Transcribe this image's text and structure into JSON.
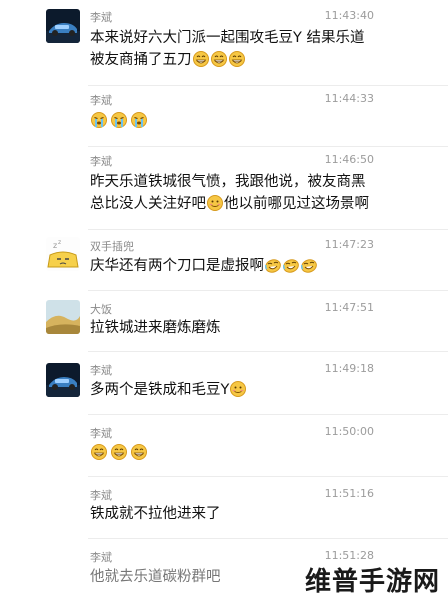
{
  "messages": [
    {
      "sender": "李斌",
      "time": "11:43:40",
      "avatar": "car-photo-avatar",
      "lines": [
        "本来说好六大门派一起围攻毛豆Y 结果乐道",
        "被友商捅了五刀"
      ]
    },
    {
      "sender": "李斌",
      "time": "11:44:33",
      "avatar": "none",
      "lines": []
    },
    {
      "sender": "李斌",
      "time": "11:46:50",
      "avatar": "none",
      "lines": [
        "昨天乐道铁城很气愤，我跟他说，被友商黑",
        "总比没人关注好吧",
        "他以前哪见过这场景啊"
      ]
    },
    {
      "sender": "双手插兜",
      "time": "11:47:23",
      "avatar": "cartoon-avatar",
      "lines": [
        "庆华还有两个刀口是虚报啊"
      ]
    },
    {
      "sender": "大饭",
      "time": "11:47:51",
      "avatar": "landscape-avatar",
      "lines": [
        "拉铁城进来磨炼磨炼"
      ]
    },
    {
      "sender": "李斌",
      "time": "11:49:18",
      "avatar": "car-photo-avatar",
      "lines": [
        "多两个是铁成和毛豆Y"
      ]
    },
    {
      "sender": "李斌",
      "time": "11:50:00",
      "avatar": "none",
      "lines": []
    },
    {
      "sender": "李斌",
      "time": "11:51:16",
      "avatar": "none",
      "lines": [
        "铁成就不拉他进来了"
      ]
    },
    {
      "sender": "李斌",
      "time": "11:51:28",
      "avatar": "none",
      "lines": [
        "他就去乐道碳粉群吧"
      ]
    }
  ],
  "emoji": {
    "grin": "grin-emoji-icon",
    "sob": "crying-emoji-icon",
    "awkward": "awkward-emoji-icon",
    "cry_laugh": "tears-of-joy-emoji-icon"
  },
  "watermark": "维普手游网",
  "colors": {
    "name": "#8a8a8a",
    "time": "#9c9c9c",
    "text": "#111111",
    "separator": "#ececec"
  }
}
